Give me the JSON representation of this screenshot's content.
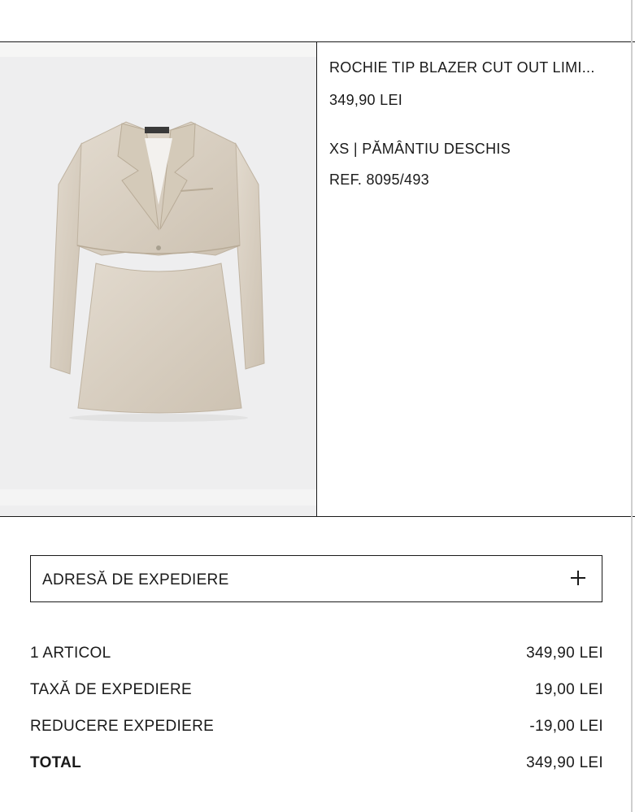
{
  "product": {
    "title": "ROCHIE TIP BLAZER CUT OUT LIMI...",
    "price": "349,90 LEI",
    "variant": "XS | PĂMÂNTIU DESCHIS",
    "reference": "REF. 8095/493",
    "image_icon": "blazer-dress-product-image"
  },
  "shipping_address": {
    "label": "ADRESĂ DE EXPEDIERE",
    "action_icon": "plus-icon"
  },
  "summary": {
    "rows": [
      {
        "label": "1 ARTICOL",
        "value": "349,90 LEI"
      },
      {
        "label": "TAXĂ DE EXPEDIERE",
        "value": "19,00 LEI"
      },
      {
        "label": "REDUCERE EXPEDIERE",
        "value": "-19,00 LEI"
      },
      {
        "label": "TOTAL",
        "value": "349,90 LEI"
      }
    ]
  },
  "colors": {
    "text": "#1a1a1a",
    "divider": "#1a1a1a",
    "product_fabric": "#d8cfc2"
  }
}
